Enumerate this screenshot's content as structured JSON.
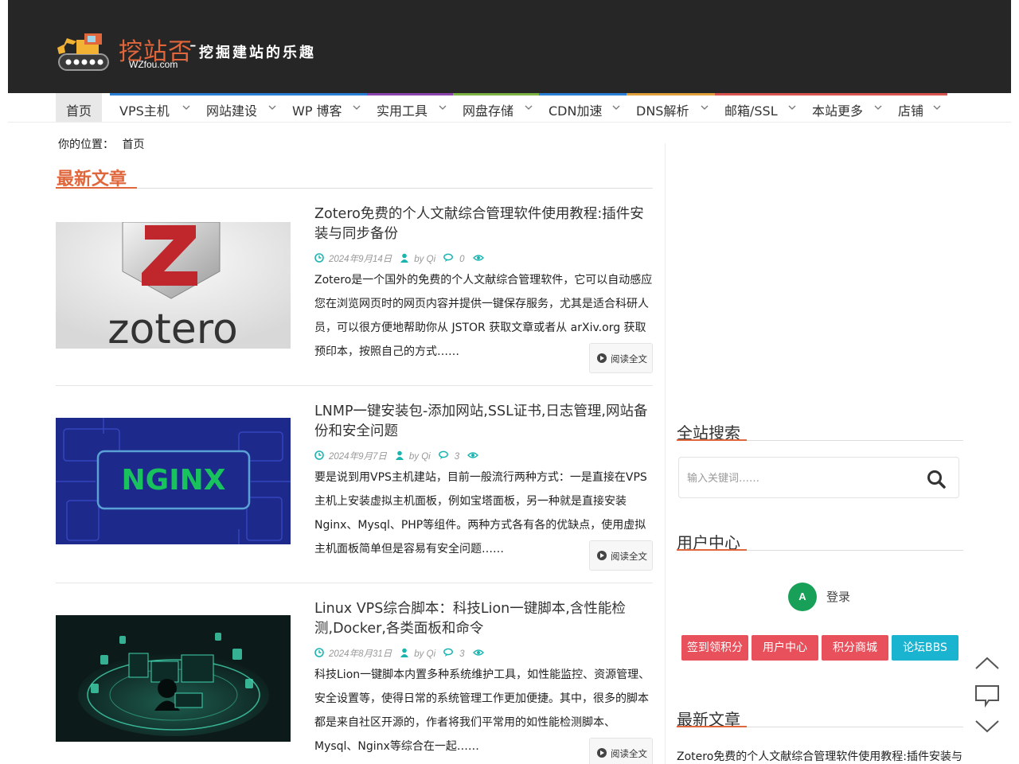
{
  "site": {
    "logo_title": "挖站否",
    "logo_dash": "-",
    "logo_tagline": "挖掘建站的乐趣",
    "logo_domain": "WZfou.com"
  },
  "nav": {
    "items": [
      {
        "label": "首页",
        "color": "#e8e8e8",
        "has_submenu": false
      },
      {
        "label": "VPS主机",
        "color": "#2a7fd4",
        "has_submenu": true
      },
      {
        "label": "网站建设",
        "color": "#2a7fd4",
        "has_submenu": true
      },
      {
        "label": "WP 博客",
        "color": "#2a7fd4",
        "has_submenu": true
      },
      {
        "label": "实用工具",
        "color": "#8e44ad",
        "has_submenu": true
      },
      {
        "label": "网盘存储",
        "color": "#7cb342",
        "has_submenu": true
      },
      {
        "label": "CDN加速",
        "color": "#2a7fd4",
        "has_submenu": true
      },
      {
        "label": "DNS解析",
        "color": "#e0a03b",
        "has_submenu": true
      },
      {
        "label": "邮箱/SSL",
        "color": "#d9534f",
        "has_submenu": true
      },
      {
        "label": "本站更多",
        "color": "#d9534f",
        "has_submenu": true
      },
      {
        "label": "店铺",
        "color": "#d9534f",
        "has_submenu": true
      }
    ]
  },
  "breadcrumb": {
    "prefix": "你的位置：",
    "current": "首页"
  },
  "main": {
    "section_title": "最新文章",
    "read_more_label": "阅读全文",
    "articles": [
      {
        "title": "Zotero免费的个人文献综合管理软件使用教程:插件安装与同步备份",
        "date": "2024年9月14日",
        "author": "by Qi",
        "comments": "0",
        "excerpt": "Zotero是一个国外的免费的个人文献综合管理软件，它可以自动感应您在浏览网页时的网页内容并提供一键保存服务，尤其是适合科研人员，可以很方便地帮助你从 JSTOR 获取文章或者从 arXiv.org 获取预印本，按照自己的方式……",
        "thumb_text": "zotero",
        "thumb_letter": "Z"
      },
      {
        "title": "LNMP一键安装包-添加网站,SSL证书,日志管理,网站备份和安全问题",
        "date": "2024年9月7日",
        "author": "by Qi",
        "comments": "3",
        "excerpt": "要是说到用VPS主机建站，目前一般流行两种方式：一是直接在VPS主机上安装虚拟主机面板，例如宝塔面板，另一种就是直接安装Nginx、Mysql、PHP等组件。两种方式各有各的优缺点，使用虚拟主机面板简单但是容易有安全问题……",
        "thumb_text": "NGINX"
      },
      {
        "title": "Linux VPS综合脚本：科技Lion一键脚本,含性能检测,Docker,各类面板和命令",
        "date": "2024年8月31日",
        "author": "by Qi",
        "comments": "3",
        "excerpt": "科技Lion一键脚本内置多种系统维护工具，如性能监控、资源管理、安全设置等，使得日常的系统管理工作更加便捷。其中，很多的脚本都是来自社区开源的，作者将我们平常用的如性能检测脚本、Mysql、Nginx等综合在一起……"
      }
    ]
  },
  "sidebar": {
    "search_title": "全站搜索",
    "search_placeholder": "输入关键词……",
    "user_center_title": "用户中心",
    "avatar_letter": "A",
    "login_label": "登录",
    "buttons": [
      {
        "label": "签到领积分",
        "color": "#e8505b"
      },
      {
        "label": "用户中心",
        "color": "#e8505b"
      },
      {
        "label": "积分商城",
        "color": "#e8505b"
      },
      {
        "label": "论坛BBS",
        "color": "#1ab3d0"
      }
    ],
    "latest_title": "最新文章",
    "latest_first": "Zotero免费的个人文献综合管理软件使用教程:插件安装与"
  },
  "colors": {
    "accent": "#e0663b",
    "header_bg": "#262626",
    "meta_icon": "#1bb5b0"
  }
}
